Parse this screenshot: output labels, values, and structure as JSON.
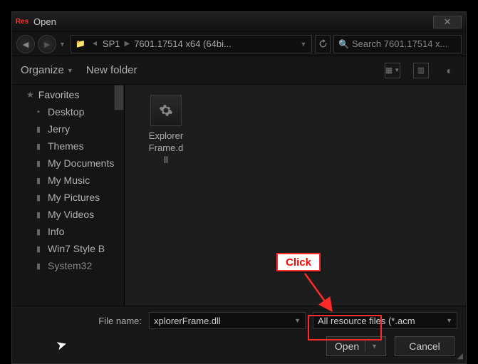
{
  "title": "Open",
  "app_icon_label": "Res",
  "nav": {
    "crumb_icon": "📁",
    "crumb1": "SP1",
    "crumb2": "7601.17514 x64 (64bi...",
    "search_placeholder": "Search 7601.17514 x..."
  },
  "toolbar": {
    "organize": "Organize",
    "newfolder": "New folder"
  },
  "sidebar": {
    "section": "Favorites",
    "items": [
      "Desktop",
      "Jerry",
      "Themes",
      "My Documents",
      "My Music",
      "My Pictures",
      "My Videos",
      "Info",
      "Win7 Style B",
      "System32"
    ]
  },
  "file": {
    "name": "ExplorerFrame.dll"
  },
  "footer": {
    "filename_label": "File name:",
    "filename_value": "xplorerFrame.dll",
    "filetype": "All resource files (*.acm",
    "open": "Open",
    "cancel": "Cancel"
  },
  "annotation": {
    "click": "Click"
  }
}
